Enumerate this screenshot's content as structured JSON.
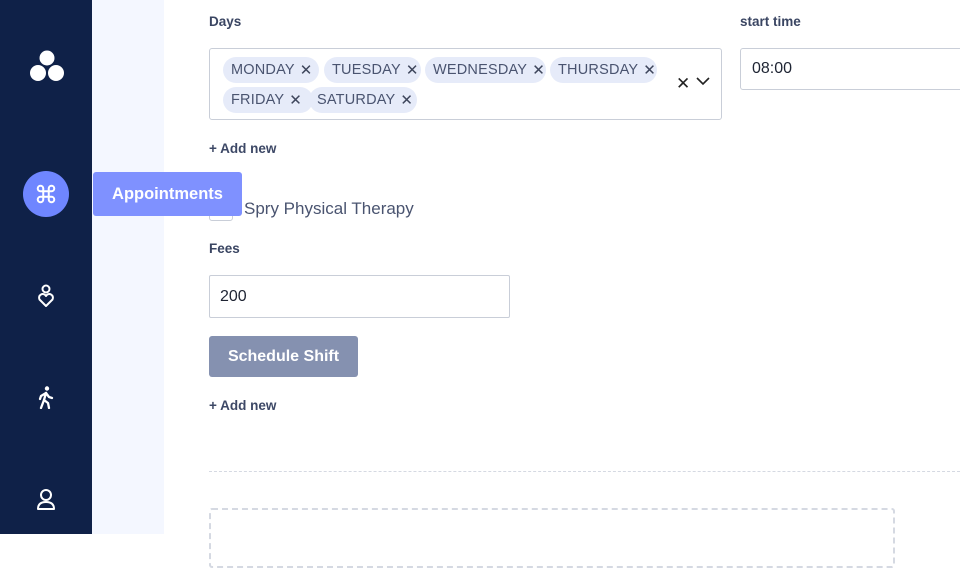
{
  "sidebar": {
    "items": [
      {
        "name": "logo",
        "icon": "three-circles-icon"
      },
      {
        "name": "appointments",
        "icon": "command-icon",
        "active": true
      },
      {
        "name": "care",
        "icon": "heart-person-icon"
      },
      {
        "name": "activity",
        "icon": "walking-icon"
      },
      {
        "name": "profile",
        "icon": "user-icon"
      }
    ],
    "tooltip": "Appointments"
  },
  "form": {
    "days_label": "Days",
    "days": [
      "MONDAY",
      "TUESDAY",
      "WEDNESDAY",
      "THURSDAY",
      "FRIDAY",
      "SATURDAY"
    ],
    "chip_remove": "✕",
    "clear": "✕",
    "start_time_label": "start time",
    "start_time_value": "08:00",
    "add_new_1": "+ Add new",
    "checkbox_label": "Spry Physical Therapy",
    "fees_label": "Fees",
    "fees_value": "200",
    "schedule_button": "Schedule Shift",
    "add_new_2": "+ Add new"
  },
  "colors": {
    "sidebar_bg": "#0f2148",
    "accent": "#6f86ff",
    "button_bg": "#8591b0",
    "chip_bg": "#e6ebf9"
  }
}
